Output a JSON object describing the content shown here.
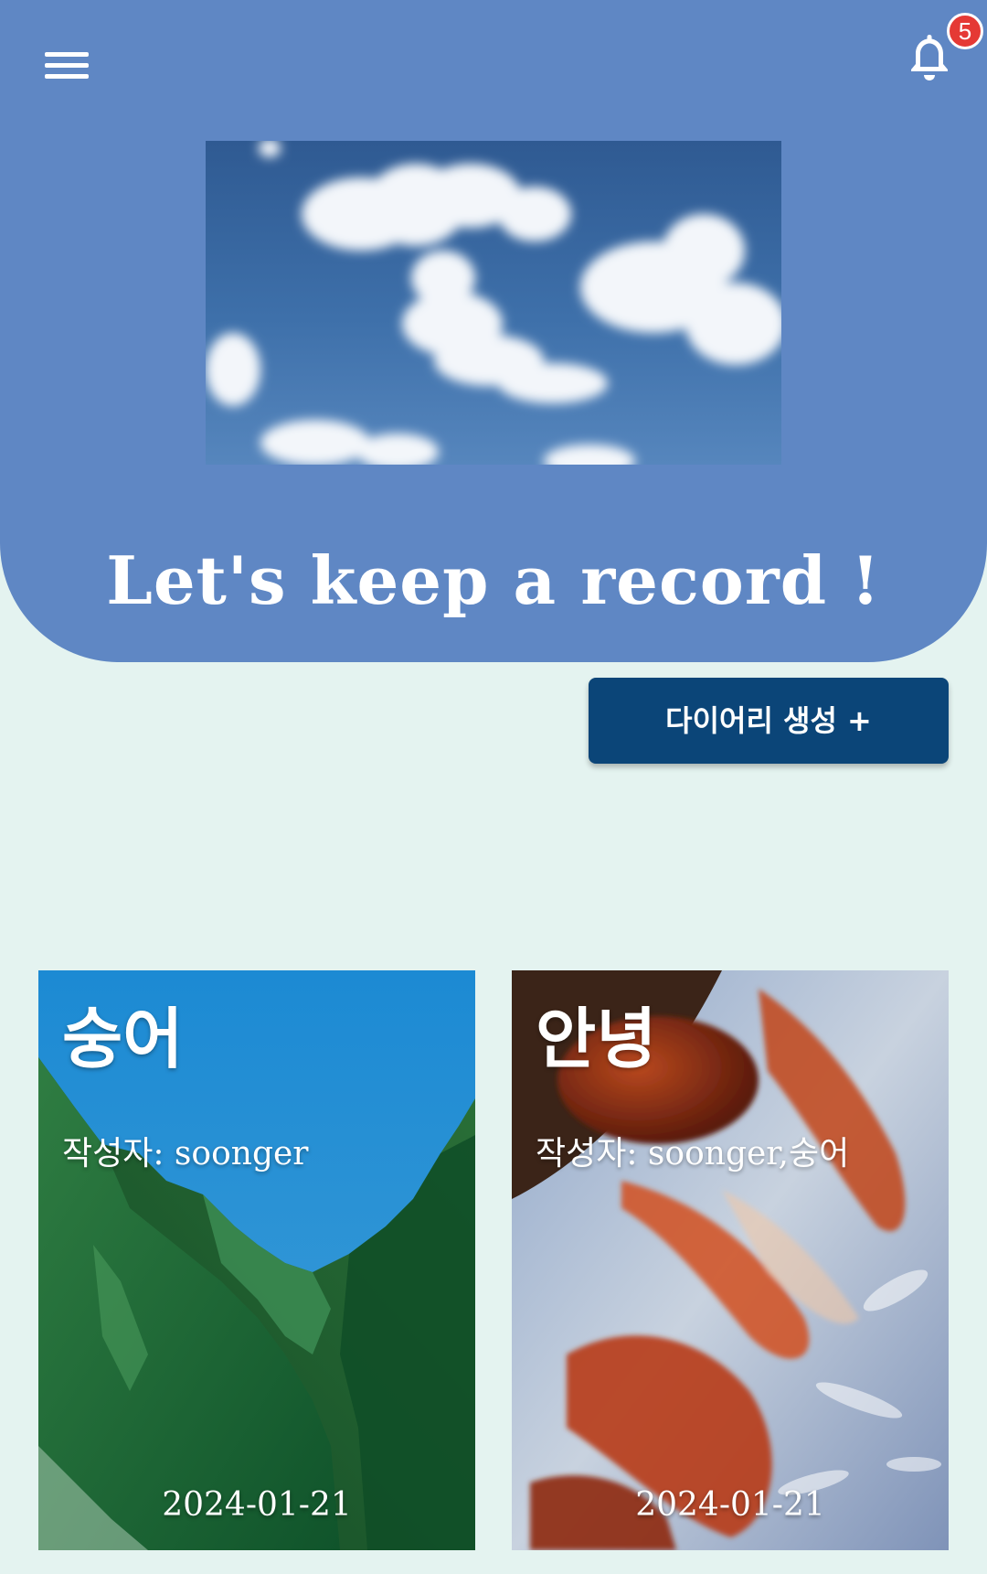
{
  "header": {
    "title": "Let's keep a record !",
    "notification_count": "5",
    "background_color": "#5f87c4",
    "menu_icon": "hamburger-menu-icon",
    "bell_icon": "bell-icon"
  },
  "actions": {
    "create_diary_label": "다이어리 생성 +",
    "button_color": "#0b4578"
  },
  "diaries": [
    {
      "title": "숭어",
      "author": "작성자: soonger",
      "date": "2024-01-21"
    },
    {
      "title": "안녕",
      "author": "작성자: soonger,숭어",
      "date": "2024-01-21"
    }
  ],
  "page_background": "#e4f3f0"
}
